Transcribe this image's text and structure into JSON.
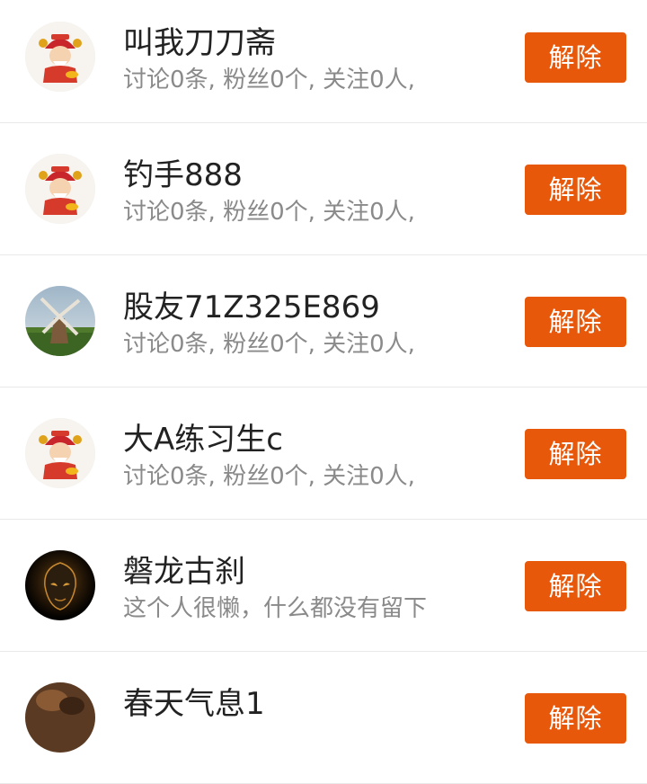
{
  "rows": [
    {
      "avatar": "god-of-wealth-avatar-icon",
      "name": "叫我刀刀斋",
      "stats": "讨论0条, 粉丝0个, 关注0人,",
      "action": "解除"
    },
    {
      "avatar": "god-of-wealth-avatar-icon",
      "name": "钓手888",
      "stats": "讨论0条, 粉丝0个, 关注0人,",
      "action": "解除"
    },
    {
      "avatar": "windmill-photo-avatar",
      "name": "股友71Z325E869",
      "stats": "讨论0条, 粉丝0个, 关注0人,",
      "action": "解除"
    },
    {
      "avatar": "god-of-wealth-avatar-icon",
      "name": "大A练习生c",
      "stats": "讨论0条, 粉丝0个, 关注0人,",
      "action": "解除"
    },
    {
      "avatar": "dark-mask-photo-avatar",
      "name": "磐龙古刹",
      "stats": "这个人很懒，什么都没有留下",
      "action": "解除"
    },
    {
      "avatar": "brown-photo-avatar",
      "name": "春天气息1",
      "stats": "",
      "action": "解除"
    }
  ],
  "colors": {
    "button": "#e8580b",
    "name_text": "#222222",
    "sub_text": "#8a8a8a",
    "divider": "#e9e9e9"
  }
}
